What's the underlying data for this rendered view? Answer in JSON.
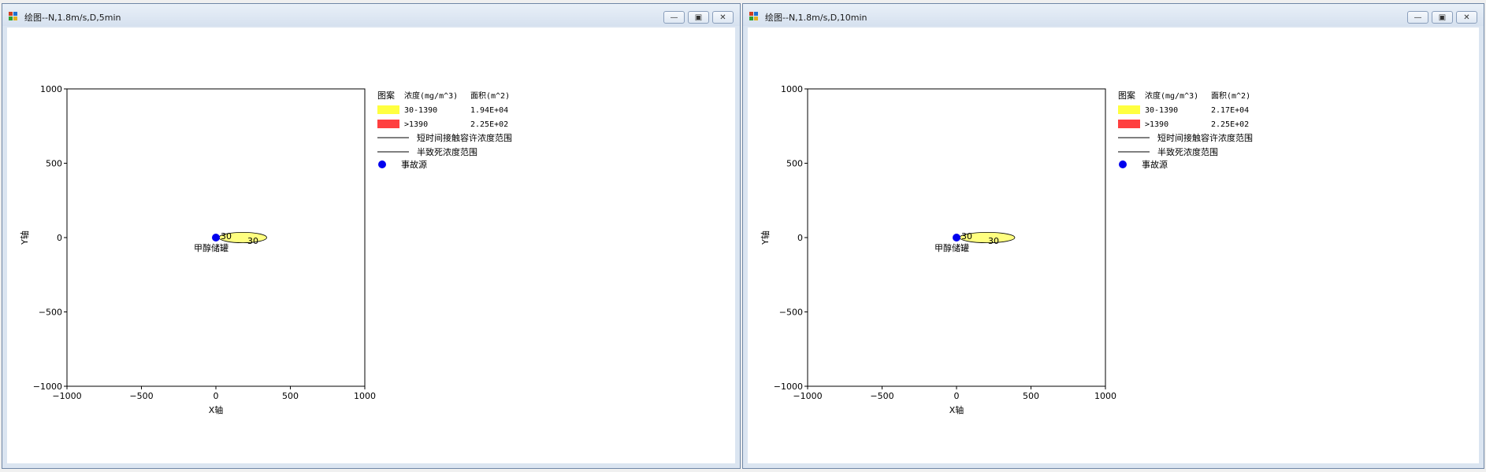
{
  "windows": [
    {
      "title": "绘图--N,1.8m/s,D,5min",
      "buttons": [
        "minimize-icon",
        "restore-icon",
        "close-icon"
      ],
      "chart_data": {
        "type": "scatter",
        "xlabel": "X轴",
        "ylabel": "Y轴",
        "xlim": [
          -1000,
          1000
        ],
        "ylim": [
          -1000,
          1000
        ],
        "xticks": [
          "−1000",
          "−500",
          "0",
          "500",
          "1000"
        ],
        "yticks": [
          "1000",
          "500",
          "0",
          "−500",
          "−1000"
        ],
        "source": {
          "x": 0,
          "y": 0,
          "label": "甲醇储罐"
        },
        "plume": {
          "x_start": 0,
          "x_end": 320,
          "y_half_width": 35,
          "contour_label": "30",
          "inner_label": "30"
        },
        "legend": {
          "header": [
            "图案",
            "浓度(mg/m^3)",
            "面积(m^2)"
          ],
          "rows": [
            {
              "color": "#ffff40",
              "range": "30-1390",
              "area": "1.94E+04"
            },
            {
              "color": "#ff4040",
              "range": ">1390",
              "area": "2.25E+02"
            }
          ],
          "lines": [
            "短时间接触容许浓度范围",
            "半致死浓度范围"
          ],
          "marker": "事故源"
        }
      }
    },
    {
      "title": "绘图--N,1.8m/s,D,10min",
      "buttons": [
        "minimize-icon",
        "restore-icon",
        "close-icon"
      ],
      "chart_data": {
        "type": "scatter",
        "xlabel": "X轴",
        "ylabel": "Y轴",
        "xlim": [
          -1000,
          1000
        ],
        "ylim": [
          -1000,
          1000
        ],
        "xticks": [
          "−1000",
          "−500",
          "0",
          "500",
          "1000"
        ],
        "yticks": [
          "1000",
          "500",
          "0",
          "−500",
          "−1000"
        ],
        "source": {
          "x": 0,
          "y": 0,
          "label": "甲醇储罐"
        },
        "plume": {
          "x_start": 0,
          "x_end": 370,
          "y_half_width": 35,
          "contour_label": "30",
          "inner_label": "30"
        },
        "legend": {
          "header": [
            "图案",
            "浓度(mg/m^3)",
            "面积(m^2)"
          ],
          "rows": [
            {
              "color": "#ffff40",
              "range": "30-1390",
              "area": "2.17E+04"
            },
            {
              "color": "#ff4040",
              "range": ">1390",
              "area": "2.25E+02"
            }
          ],
          "lines": [
            "短时间接触容许浓度范围",
            "半致死浓度范围"
          ],
          "marker": "事故源"
        }
      }
    }
  ]
}
